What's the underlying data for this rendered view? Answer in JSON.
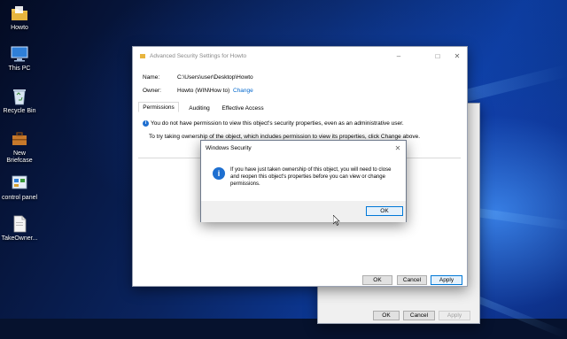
{
  "desktop": {
    "icons": [
      {
        "label": "Howto",
        "icon": "folder-icon"
      },
      {
        "label": "This PC",
        "icon": "computer-icon"
      },
      {
        "label": "Recycle Bin",
        "icon": "recycle-bin-icon"
      },
      {
        "label": "New Briefcase",
        "icon": "briefcase-icon"
      },
      {
        "label": "control panel",
        "icon": "control-panel-icon"
      },
      {
        "label": "TakeOwner...",
        "icon": "file-icon"
      }
    ]
  },
  "main_window": {
    "title": "Advanced Security Settings for Howto",
    "name_label": "Name:",
    "name_value": "C:\\Users\\user\\Desktop\\Howto",
    "owner_label": "Owner:",
    "owner_value": "Howto (WIN\\How to)",
    "change_link": "Change",
    "tabs": [
      "Permissions",
      "Auditing",
      "Effective Access"
    ],
    "info_text": "You do not have permission to view this object's security properties, even as an administrative user.",
    "ownership_text": "To try taking ownership of the object, which includes permission to view its properties, click Change above.",
    "buttons": {
      "ok": "OK",
      "cancel": "Cancel",
      "apply": "Apply"
    }
  },
  "back_window": {
    "buttons": {
      "ok": "OK",
      "cancel": "Cancel",
      "apply": "Apply"
    }
  },
  "dialog": {
    "title": "Windows Security",
    "message": "If you have just taken ownership of this object, you will need to close and reopen this object's properties before you can view or change permissions.",
    "ok": "OK"
  },
  "colors": {
    "accent": "#0078d7",
    "link": "#0066cc",
    "info_icon": "#1e6fd0"
  }
}
